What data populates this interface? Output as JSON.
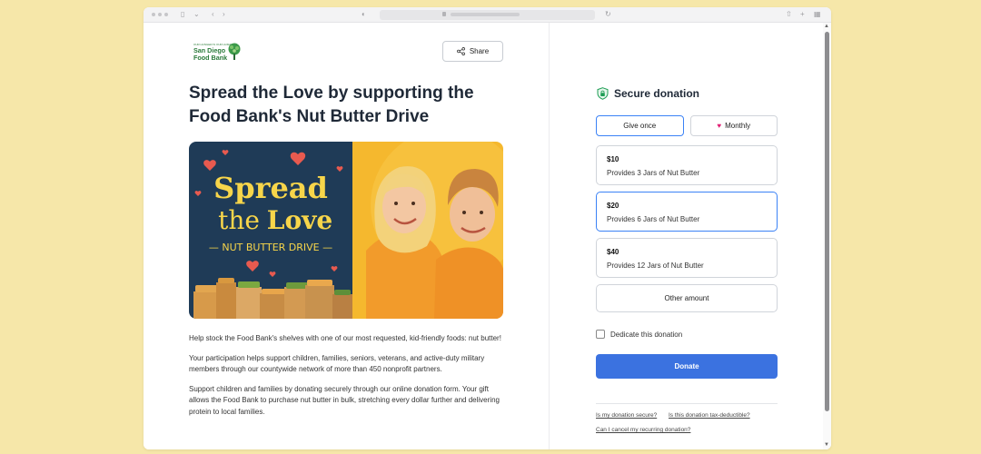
{
  "browser": {
    "icons": [
      "sidebar-icon",
      "back-icon",
      "forward-icon",
      "shield-icon",
      "reload-icon",
      "share-icon",
      "new-tab-icon",
      "tabs-overview-icon"
    ]
  },
  "logo": {
    "tagline": "OUR HUNGER IS OUR HUMANITY",
    "name_line1": "San Diego",
    "name_line2": "Food Bank"
  },
  "header": {
    "share_label": "Share"
  },
  "page": {
    "title": "Spread the Love by supporting the Food Bank's Nut Butter Drive",
    "hero": {
      "line1": "Spread",
      "line2_a": "the",
      "line2_b": "Love",
      "subtitle": "— NUT BUTTER DRIVE —"
    },
    "paragraphs": [
      "Help stock the Food Bank's shelves with one of our most requested, kid-friendly foods: nut butter!",
      "Your participation helps support children, families, seniors, veterans, and active-duty military members through our countywide network of more than 450 nonprofit partners.",
      "Support children and families by donating securely through our online donation form. Your gift allows the Food Bank to purchase nut butter in bulk, stretching every dollar further and delivering protein to local families."
    ]
  },
  "donation": {
    "title": "Secure donation",
    "frequency": {
      "once_label": "Give once",
      "monthly_label": "Monthly",
      "selected": "once"
    },
    "options": [
      {
        "amount": "$10",
        "description": "Provides 3 Jars of Nut Butter",
        "selected": false
      },
      {
        "amount": "$20",
        "description": "Provides 6 Jars of Nut Butter",
        "selected": true
      },
      {
        "amount": "$40",
        "description": "Provides 12 Jars of Nut Butter",
        "selected": false
      }
    ],
    "other_label": "Other amount",
    "dedicate_label": "Dedicate this donation",
    "dedicate_checked": false,
    "donate_label": "Donate",
    "faq": [
      "Is my donation secure?",
      "Is this donation tax-deductible?",
      "Can I cancel my recurring donation?"
    ]
  },
  "colors": {
    "background": "#f6e7a9",
    "accent": "#3b72e0",
    "selected_border": "#3b82f6",
    "heart": "#e11d74",
    "logo_green": "#2a7a3a",
    "hero_navy": "#1f3b57",
    "hero_yellow": "#f5b82e"
  }
}
